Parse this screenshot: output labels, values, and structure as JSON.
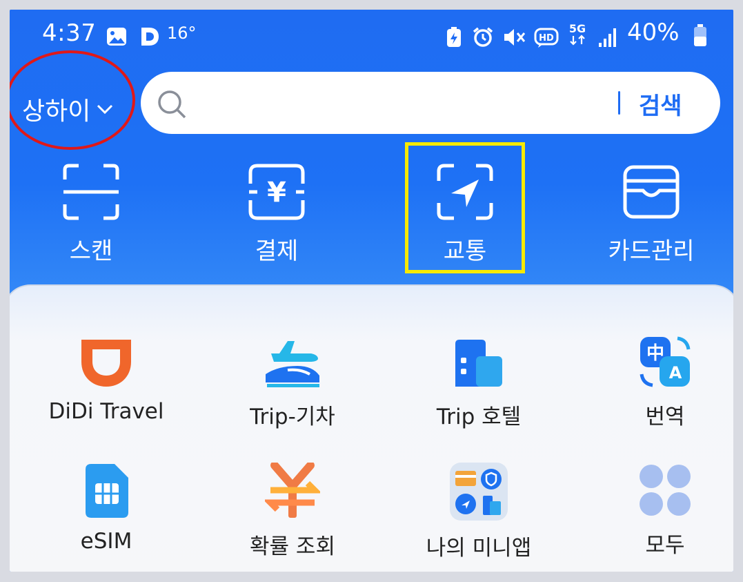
{
  "status_bar": {
    "time": "4:37",
    "temperature": "16°",
    "battery": "40%",
    "icons": [
      "gallery-icon",
      "d-app-icon",
      "battery-saver-icon",
      "alarm-icon",
      "mute-icon",
      "hd-icon",
      "5g-icon",
      "signal-icon",
      "battery-icon"
    ]
  },
  "header": {
    "city": "상하이",
    "search": {
      "placeholder": "",
      "button_label": "검색"
    }
  },
  "quick_actions": [
    {
      "label": "스캔",
      "icon": "scan-icon"
    },
    {
      "label": "결제",
      "icon": "yuan-pay-icon"
    },
    {
      "label": "교통",
      "icon": "transit-icon"
    },
    {
      "label": "카드관리",
      "icon": "wallet-icon"
    }
  ],
  "mini_apps": [
    {
      "label": "DiDi Travel",
      "icon": "didi-icon"
    },
    {
      "label": "Trip-기차",
      "icon": "train-icon"
    },
    {
      "label": "Trip 호텔",
      "icon": "hotel-icon"
    },
    {
      "label": "번역",
      "icon": "translate-icon"
    },
    {
      "label": "eSIM",
      "icon": "esim-icon"
    },
    {
      "label": "확률 조회",
      "icon": "exchange-rate-icon"
    },
    {
      "label": "나의 미니앱",
      "icon": "my-miniapps-icon"
    },
    {
      "label": "모두",
      "icon": "all-apps-icon"
    }
  ],
  "colors": {
    "primary": "#1e6cf4",
    "highlight_circle": "#e01818",
    "highlight_box": "#f6ea00"
  }
}
